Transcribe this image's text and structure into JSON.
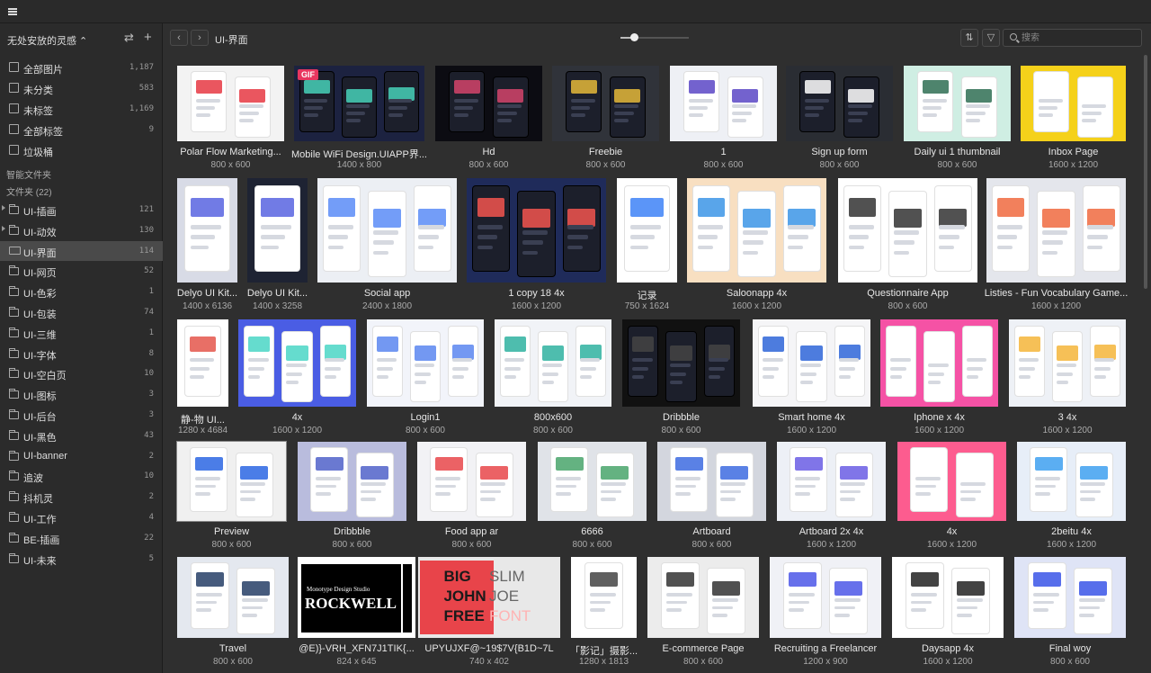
{
  "sidebar": {
    "library_name": "无处安放的灵感 ⌃",
    "system_items": [
      {
        "label": "全部图片",
        "count": "1,187",
        "icon": "image-icon"
      },
      {
        "label": "未分类",
        "count": "583",
        "icon": "uncategorized-icon"
      },
      {
        "label": "未标签",
        "count": "1,169",
        "icon": "untagged-icon"
      },
      {
        "label": "全部标签",
        "count": "9",
        "icon": "tag-icon"
      },
      {
        "label": "垃圾桶",
        "count": "",
        "icon": "trash-icon"
      }
    ],
    "smart_folders_label": "智能文件夹",
    "folders_label": "文件夹 (22)",
    "folders": [
      {
        "label": "UI-插画",
        "count": "121",
        "expandable": true
      },
      {
        "label": "UI-动效",
        "count": "130",
        "expandable": true
      },
      {
        "label": "UI-界面",
        "count": "114",
        "active": true
      },
      {
        "label": "UI-网页",
        "count": "52"
      },
      {
        "label": "UI-色彩",
        "count": "1"
      },
      {
        "label": "UI-包装",
        "count": "74"
      },
      {
        "label": "UI-三维",
        "count": "1"
      },
      {
        "label": "UI-字体",
        "count": "8"
      },
      {
        "label": "UI-空白页",
        "count": "10"
      },
      {
        "label": "UI-图标",
        "count": "3"
      },
      {
        "label": "UI-后台",
        "count": "3"
      },
      {
        "label": "UI-黑色",
        "count": "43"
      },
      {
        "label": "UI-banner",
        "count": "2"
      },
      {
        "label": "追波",
        "count": "10"
      },
      {
        "label": "抖机灵",
        "count": "2"
      },
      {
        "label": "UI-工作",
        "count": "4"
      },
      {
        "label": "BE-插画",
        "count": "22"
      },
      {
        "label": "UI-未来",
        "count": "5"
      }
    ]
  },
  "toolbar": {
    "back_label": "‹",
    "forward_label": "›",
    "breadcrumb": "UI-界面",
    "zoom_value": 0.2,
    "sort_label": "⇅",
    "filter_label": "▽",
    "search_placeholder": "搜索"
  },
  "grid": {
    "rows": [
      [
        {
          "name": "Polar Flow Marketing...",
          "dims": "800 x 600",
          "bg": "#f3f3f3",
          "accent": "#e63843",
          "style": "phones"
        },
        {
          "name": "Mobile WiFi Design.UIAPP界...",
          "dims": "1400 x 800",
          "bg": "#1c2240",
          "accent": "#46d1b8",
          "style": "dark",
          "gif": "GIF"
        },
        {
          "name": "Hd",
          "dims": "800 x 600",
          "bg": "#0c0c12",
          "accent": "#d4446b",
          "style": "dark"
        },
        {
          "name": "Freebie",
          "dims": "800 x 600",
          "bg": "#30333a",
          "accent": "#e4b93a",
          "style": "dark"
        },
        {
          "name": "1",
          "dims": "800 x 600",
          "bg": "#eef0f5",
          "accent": "#5a47c6",
          "style": "phones"
        },
        {
          "name": "Sign up form",
          "dims": "800 x 600",
          "bg": "#2a2d33",
          "accent": "#ffffff",
          "style": "dark"
        },
        {
          "name": "Daily ui 1 thumbnail",
          "dims": "800 x 600",
          "bg": "#cfeee3",
          "accent": "#2f6e54",
          "style": "phones"
        },
        {
          "name": "Inbox Page",
          "dims": "1600 x 1200",
          "bg": "#f5d11a",
          "accent": "#ffffff",
          "style": "phones"
        }
      ],
      [
        {
          "name": "Delyo UI Kit...",
          "dims": "1400 x 6136",
          "bg": "#d8dbe6",
          "accent": "#5864e0",
          "style": "phones"
        },
        {
          "name": "Delyo UI Kit...",
          "dims": "1400 x 3258",
          "bg": "#1e2333",
          "accent": "#5864e0",
          "style": "phones"
        },
        {
          "name": "Social app",
          "dims": "2400 x 1800",
          "bg": "#eceff4",
          "accent": "#5b8cf7",
          "style": "phones"
        },
        {
          "name": "1 copy 18 4x",
          "dims": "1600 x 1200",
          "bg": "#1f2b5a",
          "accent": "#f2554f",
          "style": "dark"
        },
        {
          "name": "记录",
          "dims": "750 x 1624",
          "bg": "#ffffff",
          "accent": "#3e82f7",
          "style": "phones"
        },
        {
          "name": "Saloonapp 4x",
          "dims": "1600 x 1200",
          "bg": "#f8dfc1",
          "accent": "#3c95e6",
          "style": "phones"
        },
        {
          "name": "Questionnaire App",
          "dims": "800 x 600",
          "bg": "#ffffff",
          "accent": "#333333",
          "style": "phones"
        },
        {
          "name": "Listies - Fun Vocabulary Game...",
          "dims": "1600 x 1200",
          "bg": "#e4e6ec",
          "accent": "#f06a3f",
          "style": "phones"
        }
      ],
      [
        {
          "name": "静-物 UI...",
          "dims": "1280 x 4684",
          "bg": "#ffffff",
          "accent": "#e4564b",
          "style": "phones"
        },
        {
          "name": "4x",
          "dims": "1600 x 1200",
          "bg": "#4a5de4",
          "accent": "#4ad6c6",
          "style": "phones"
        },
        {
          "name": "Login1",
          "dims": "800 x 600",
          "bg": "#f2f4fa",
          "accent": "#5a86f0",
          "style": "phones"
        },
        {
          "name": "800x600",
          "dims": "800 x 600",
          "bg": "#f1f3f7",
          "accent": "#2fb1a0",
          "style": "phones"
        },
        {
          "name": "Dribbble",
          "dims": "800 x 600",
          "bg": "#111111",
          "accent": "#444444",
          "style": "dark"
        },
        {
          "name": "Smart home 4x",
          "dims": "1600 x 1200",
          "bg": "#f5f5f7",
          "accent": "#2e65d8",
          "style": "phones"
        },
        {
          "name": "Iphone x 4x",
          "dims": "1600 x 1200",
          "bg": "#f552a5",
          "accent": "#ffffff",
          "style": "phones"
        },
        {
          "name": "3 4x",
          "dims": "1600 x 1200",
          "bg": "#eef1f6",
          "accent": "#f4b53a",
          "style": "phones"
        }
      ],
      [
        {
          "name": "Preview",
          "dims": "800 x 600",
          "bg": "#f0f0f0",
          "accent": "#2b66e3",
          "style": "phones",
          "sel": true
        },
        {
          "name": "Dribbble",
          "dims": "800 x 600",
          "bg": "#b9bcdd",
          "accent": "#5062c9",
          "style": "phones"
        },
        {
          "name": "Food app ar",
          "dims": "800 x 600",
          "bg": "#f2f2f5",
          "accent": "#e8474a",
          "style": "phones"
        },
        {
          "name": "6666",
          "dims": "800 x 600",
          "bg": "#e0e3e8",
          "accent": "#49a56b",
          "style": "phones"
        },
        {
          "name": "Artboard",
          "dims": "800 x 600",
          "bg": "#d3d6de",
          "accent": "#3d6be0",
          "style": "phones"
        },
        {
          "name": "Artboard 2x 4x",
          "dims": "1600 x 1200",
          "bg": "#edf0f6",
          "accent": "#6a5de4",
          "style": "phones"
        },
        {
          "name": "4x",
          "dims": "1600 x 1200",
          "bg": "#fd5c8f",
          "accent": "#ffffff",
          "style": "phones"
        },
        {
          "name": "2beitu 4x",
          "dims": "1600 x 1200",
          "bg": "#e7eef8",
          "accent": "#3ea0f0",
          "style": "phones"
        }
      ],
      [
        {
          "name": "Travel",
          "dims": "800 x 600",
          "bg": "#e4e8ef",
          "accent": "#263e66",
          "style": "phones"
        },
        {
          "name": "@E)}-VRH_XFN7J1TIK{...",
          "dims": "824 x 645",
          "bg": "#ffffff",
          "accent": "#000000",
          "style": "poster"
        },
        {
          "name": "UPYUJXF@~19$7V{B1D~7L",
          "dims": "740 x 402",
          "bg": "#e8e8e8",
          "accent": "#e8444a",
          "style": "type"
        },
        {
          "name": "「影记」摄影...",
          "dims": "1280 x 1813",
          "bg": "#ffffff",
          "accent": "#444444",
          "style": "phones"
        },
        {
          "name": "E-commerce Page",
          "dims": "800 x 600",
          "bg": "#ececec",
          "accent": "#333333",
          "style": "phones"
        },
        {
          "name": "Recruiting a Freelancer",
          "dims": "1200 x 900",
          "bg": "#f0f1f6",
          "accent": "#4c57e8",
          "style": "phones"
        },
        {
          "name": "Daysapp 4x",
          "dims": "1600 x 1200",
          "bg": "#ffffff",
          "accent": "#222222",
          "style": "phones"
        },
        {
          "name": "Final woy",
          "dims": "800 x 600",
          "bg": "#dfe4f6",
          "accent": "#3a55e8",
          "style": "phones"
        }
      ]
    ],
    "type_tile": {
      "line1": "BIG",
      "line1b": "SLIM",
      "line2": "JOHN",
      "line2b": "JOE",
      "line3": "FREE",
      "line3b": "FONT"
    },
    "poster_tile": {
      "line1": "Monotype Design Studio",
      "line2": "ROCKWELL"
    }
  },
  "icons": {
    "swap": "⇄",
    "add": "+"
  }
}
